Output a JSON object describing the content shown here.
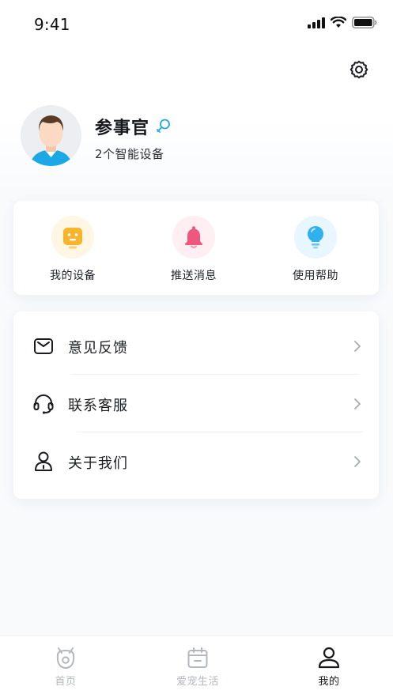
{
  "status_bar": {
    "time": "9:41"
  },
  "profile": {
    "name": "参事官",
    "device_count_text": "2个智能设备"
  },
  "quick_actions": [
    {
      "label": "我的设备",
      "icon": "robot-icon",
      "bg": "#fff6e3",
      "color": "#f6b52c"
    },
    {
      "label": "推送消息",
      "icon": "bell-icon",
      "bg": "#ffeef2",
      "color": "#f0577e"
    },
    {
      "label": "使用帮助",
      "icon": "lightbulb-icon",
      "bg": "#e7f6ff",
      "color": "#2fb1f0"
    }
  ],
  "menu": [
    {
      "label": "意见反馈",
      "icon": "mail-icon"
    },
    {
      "label": "联系客服",
      "icon": "headset-icon"
    },
    {
      "label": "关于我们",
      "icon": "person-info-icon"
    }
  ],
  "tabs": [
    {
      "label": "首页",
      "icon": "pet-face-icon",
      "active": false
    },
    {
      "label": "爱宠生活",
      "icon": "calendar-icon",
      "active": false
    },
    {
      "label": "我的",
      "icon": "user-icon",
      "active": true
    }
  ],
  "colors": {
    "accent": "#1aa8e6",
    "inactive_tab": "#b4b7bc",
    "active_tab": "#16181c"
  }
}
